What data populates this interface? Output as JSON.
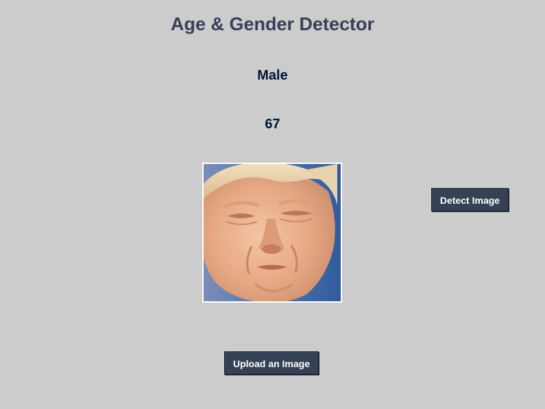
{
  "app": {
    "title": "Age & Gender Detector"
  },
  "result": {
    "gender": "Male",
    "age": "67"
  },
  "buttons": {
    "detect_label": "Detect Image",
    "upload_label": "Upload an Image"
  },
  "colors": {
    "background": "#cccccc",
    "title": "#364156",
    "result_text": "#011638",
    "button_bg": "#364156",
    "button_text": "#ffffff"
  }
}
